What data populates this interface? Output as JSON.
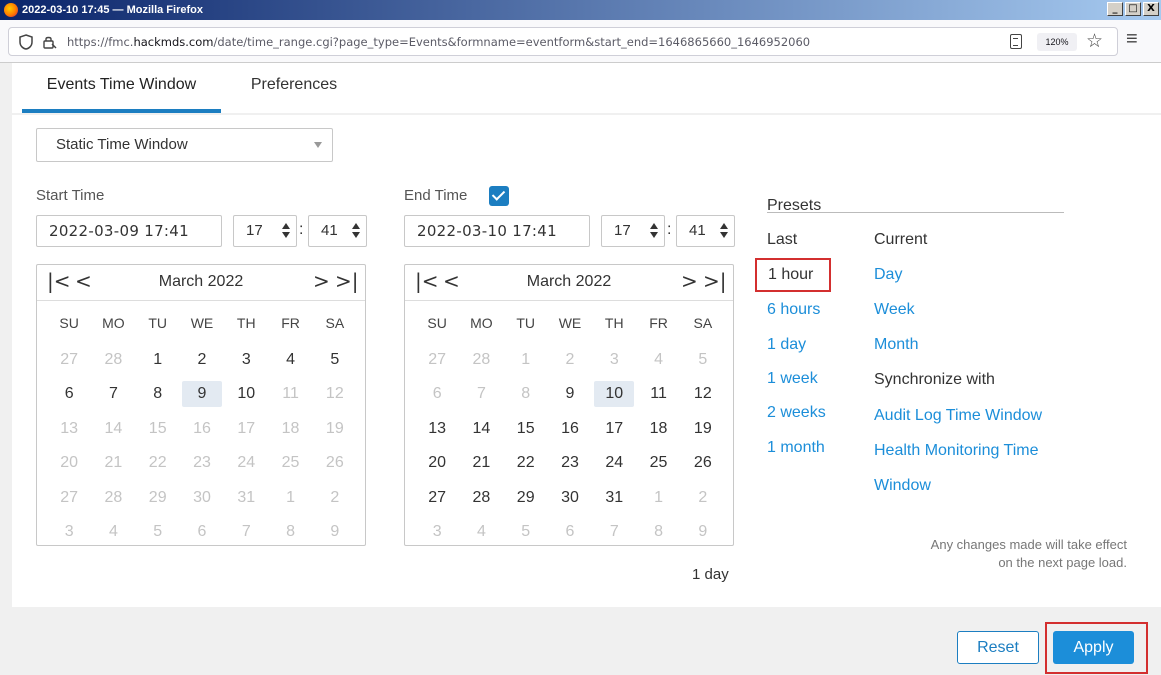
{
  "window": {
    "title": "2022-03-10 17:45 — Mozilla Firefox",
    "controls": [
      "_",
      "□",
      "X"
    ]
  },
  "navbar": {
    "url_prefix": "https://fmc.",
    "url_domain": "hackmds.com",
    "url_path": "/date/time_range.cgi?page_type=Events&formname=eventform&start_end=1646865660_1646952060",
    "zoom": "120%"
  },
  "tabs": [
    {
      "label": "Events Time Window",
      "active": true
    },
    {
      "label": "Preferences",
      "active": false
    }
  ],
  "window_type": {
    "selected": "Static Time Window"
  },
  "start": {
    "label": "Start Time",
    "datetime": "2022-03-09 17:41",
    "hour": "17",
    "minute": "41",
    "calendar": {
      "month": "March 2022",
      "nav": {
        "first": "|<",
        "prev": "<",
        "next": ">",
        "last": ">|"
      },
      "weekdays": [
        "SU",
        "MO",
        "TU",
        "WE",
        "TH",
        "FR",
        "SA"
      ],
      "weeks": [
        [
          {
            "d": "27",
            "m": true
          },
          {
            "d": "28",
            "m": true
          },
          {
            "d": "1"
          },
          {
            "d": "2"
          },
          {
            "d": "3"
          },
          {
            "d": "4"
          },
          {
            "d": "5"
          }
        ],
        [
          {
            "d": "6"
          },
          {
            "d": "7"
          },
          {
            "d": "8"
          },
          {
            "d": "9",
            "s": true
          },
          {
            "d": "10"
          },
          {
            "d": "11",
            "m": true
          },
          {
            "d": "12",
            "m": true
          }
        ],
        [
          {
            "d": "13",
            "m": true
          },
          {
            "d": "14",
            "m": true
          },
          {
            "d": "15",
            "m": true
          },
          {
            "d": "16",
            "m": true
          },
          {
            "d": "17",
            "m": true
          },
          {
            "d": "18",
            "m": true
          },
          {
            "d": "19",
            "m": true
          }
        ],
        [
          {
            "d": "20",
            "m": true
          },
          {
            "d": "21",
            "m": true
          },
          {
            "d": "22",
            "m": true
          },
          {
            "d": "23",
            "m": true
          },
          {
            "d": "24",
            "m": true
          },
          {
            "d": "25",
            "m": true
          },
          {
            "d": "26",
            "m": true
          }
        ],
        [
          {
            "d": "27",
            "m": true
          },
          {
            "d": "28",
            "m": true
          },
          {
            "d": "29",
            "m": true
          },
          {
            "d": "30",
            "m": true
          },
          {
            "d": "31",
            "m": true
          },
          {
            "d": "1",
            "m": true
          },
          {
            "d": "2",
            "m": true
          }
        ],
        [
          {
            "d": "3",
            "m": true
          },
          {
            "d": "4",
            "m": true
          },
          {
            "d": "5",
            "m": true
          },
          {
            "d": "6",
            "m": true
          },
          {
            "d": "7",
            "m": true
          },
          {
            "d": "8",
            "m": true
          },
          {
            "d": "9",
            "m": true
          }
        ]
      ]
    }
  },
  "end": {
    "label": "End Time",
    "checked": true,
    "datetime": "2022-03-10 17:41",
    "hour": "17",
    "minute": "41",
    "calendar": {
      "month": "March 2022",
      "nav": {
        "first": "|<",
        "prev": "<",
        "next": ">",
        "last": ">|"
      },
      "weekdays": [
        "SU",
        "MO",
        "TU",
        "WE",
        "TH",
        "FR",
        "SA"
      ],
      "weeks": [
        [
          {
            "d": "27",
            "m": true
          },
          {
            "d": "28",
            "m": true
          },
          {
            "d": "1",
            "m": true
          },
          {
            "d": "2",
            "m": true
          },
          {
            "d": "3",
            "m": true
          },
          {
            "d": "4",
            "m": true
          },
          {
            "d": "5",
            "m": true
          }
        ],
        [
          {
            "d": "6",
            "m": true
          },
          {
            "d": "7",
            "m": true
          },
          {
            "d": "8",
            "m": true
          },
          {
            "d": "9"
          },
          {
            "d": "10",
            "s": true
          },
          {
            "d": "11"
          },
          {
            "d": "12"
          }
        ],
        [
          {
            "d": "13"
          },
          {
            "d": "14"
          },
          {
            "d": "15"
          },
          {
            "d": "16"
          },
          {
            "d": "17"
          },
          {
            "d": "18"
          },
          {
            "d": "19"
          }
        ],
        [
          {
            "d": "20"
          },
          {
            "d": "21"
          },
          {
            "d": "22"
          },
          {
            "d": "23"
          },
          {
            "d": "24"
          },
          {
            "d": "25"
          },
          {
            "d": "26"
          }
        ],
        [
          {
            "d": "27"
          },
          {
            "d": "28"
          },
          {
            "d": "29"
          },
          {
            "d": "30"
          },
          {
            "d": "31"
          },
          {
            "d": "1",
            "m": true
          },
          {
            "d": "2",
            "m": true
          }
        ],
        [
          {
            "d": "3",
            "m": true
          },
          {
            "d": "4",
            "m": true
          },
          {
            "d": "5",
            "m": true
          },
          {
            "d": "6",
            "m": true
          },
          {
            "d": "7",
            "m": true
          },
          {
            "d": "8",
            "m": true
          },
          {
            "d": "9",
            "m": true
          }
        ]
      ]
    }
  },
  "duration": "1 day",
  "presets": {
    "title": "Presets",
    "last_header": "Last",
    "current_header": "Current",
    "last": [
      "1 hour",
      "6 hours",
      "1 day",
      "1 week",
      "2 weeks",
      "1 month"
    ],
    "current": [
      "Day",
      "Week",
      "Month"
    ],
    "sync_label": "Synchronize with",
    "sync": [
      "Audit Log Time Window",
      "Health Monitoring Time",
      "Window"
    ],
    "note_line1": "Any changes made will take effect",
    "note_line2": "on the next page load."
  },
  "buttons": {
    "reset": "Reset",
    "apply": "Apply"
  },
  "colors": {
    "accent": "#1c7ec1",
    "link": "#1c8ed9",
    "highlight": "#d32f2f"
  }
}
